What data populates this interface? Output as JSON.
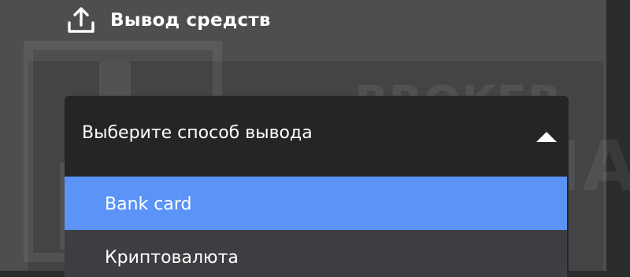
{
  "header": {
    "title": "Вывод средств",
    "icon": "upload-icon"
  },
  "watermark": {
    "line1": "BROKER",
    "line2": "TRIBUNAL"
  },
  "dropdown": {
    "label": "Выберите способ вывода",
    "caret_icon": "caret-up-icon",
    "options": [
      {
        "label": "Bank card",
        "selected": true
      },
      {
        "label": "Криптовалюта",
        "selected": false
      }
    ],
    "accent_color": "#5b94f6"
  }
}
